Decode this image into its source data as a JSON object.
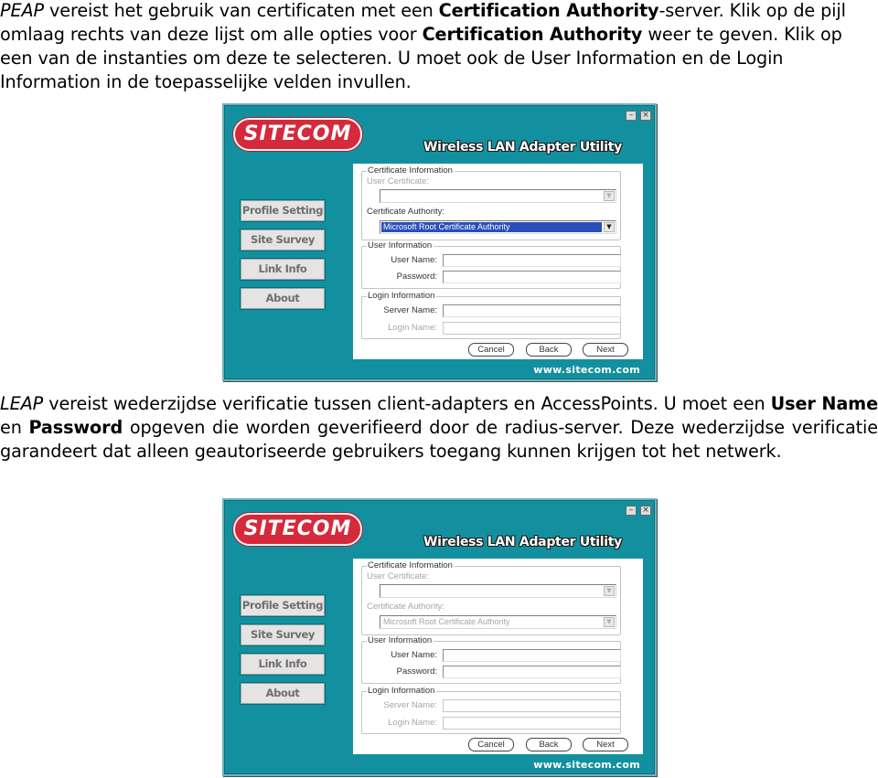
{
  "paragraph1": {
    "parts": [
      {
        "text": "PEAP",
        "style": "italic"
      },
      {
        "text": " vereist het gebruik van certificaten met een ",
        "style": "normal"
      },
      {
        "text": "Certification Authority",
        "style": "bold"
      },
      {
        "text": "-server. Klik op de pijl omlaag rechts van deze lijst om alle opties voor ",
        "style": "normal"
      },
      {
        "text": "Certification Authority",
        "style": "bold"
      },
      {
        "text": " weer te geven. Klik op een van de instanties om deze te selecteren. U moet ook de User Information en de Login Information in de toepasselijke velden invullen.",
        "style": "normal"
      }
    ]
  },
  "paragraph2": {
    "parts": [
      {
        "text": "LEAP",
        "style": "italic"
      },
      {
        "text": " vereist wederzijdse verificatie tussen client-adapters en AccessPoints. U moet een ",
        "style": "normal"
      },
      {
        "text": "User Name",
        "style": "bold"
      },
      {
        "text": " en ",
        "style": "normal"
      },
      {
        "text": "Password",
        "style": "bold"
      },
      {
        "text": " opgeven die worden geverifieerd door de radius-server. Deze wederzijdse verificatie garandeert dat alleen geautoriseerde gebruikers toegang kunnen krijgen tot het netwerk.",
        "style": "normal"
      }
    ]
  },
  "windows": [
    {
      "brand": "SITECOM",
      "title": "Wireless LAN Adapter Utility",
      "minimize_glyph": "–",
      "close_glyph": "×",
      "nav": [
        "Profile Setting",
        "Site Survey",
        "Link Info",
        "About"
      ],
      "certificate_group": "Certificate Information",
      "user_certificate_label": "User Certificate:",
      "user_certificate_value": "",
      "user_certificate_enabled": false,
      "ca_label": "Certificate Authority:",
      "ca_value": "Microsoft Root Certificate Authority",
      "ca_enabled": true,
      "ca_selected": true,
      "user_group": "User Information",
      "user_name_label": "User Name:",
      "password_label": "Password:",
      "login_group": "Login Information",
      "server_name_label": "Server Name:",
      "server_name_enabled": true,
      "login_name_label": "Login Name:",
      "login_name_enabled": false,
      "cancel": "Cancel",
      "back": "Back",
      "next": "Next",
      "url": "www.sitecom.com",
      "dropdown_arrow": "▼"
    },
    {
      "brand": "SITECOM",
      "title": "Wireless LAN Adapter Utility",
      "minimize_glyph": "–",
      "close_glyph": "×",
      "nav": [
        "Profile Setting",
        "Site Survey",
        "Link Info",
        "About"
      ],
      "certificate_group": "Certificate Information",
      "user_certificate_label": "User Certificate:",
      "user_certificate_value": "",
      "user_certificate_enabled": false,
      "ca_label": "Certificate Authority:",
      "ca_value": "Microsoft Root Certificate Authority",
      "ca_enabled": false,
      "ca_selected": false,
      "user_group": "User Information",
      "user_name_label": "User Name:",
      "password_label": "Password:",
      "login_group": "Login Information",
      "server_name_label": "Server Name:",
      "server_name_enabled": false,
      "login_name_label": "Login Name:",
      "login_name_enabled": false,
      "cancel": "Cancel",
      "back": "Back",
      "next": "Next",
      "url": "www.sitecom.com",
      "dropdown_arrow": "▼"
    }
  ],
  "colors": {
    "window_bg": "#13909f",
    "logo_red": "#d42a3c",
    "selection_blue": "#2a4fb8",
    "disabled_text": "#a6a6a6"
  }
}
